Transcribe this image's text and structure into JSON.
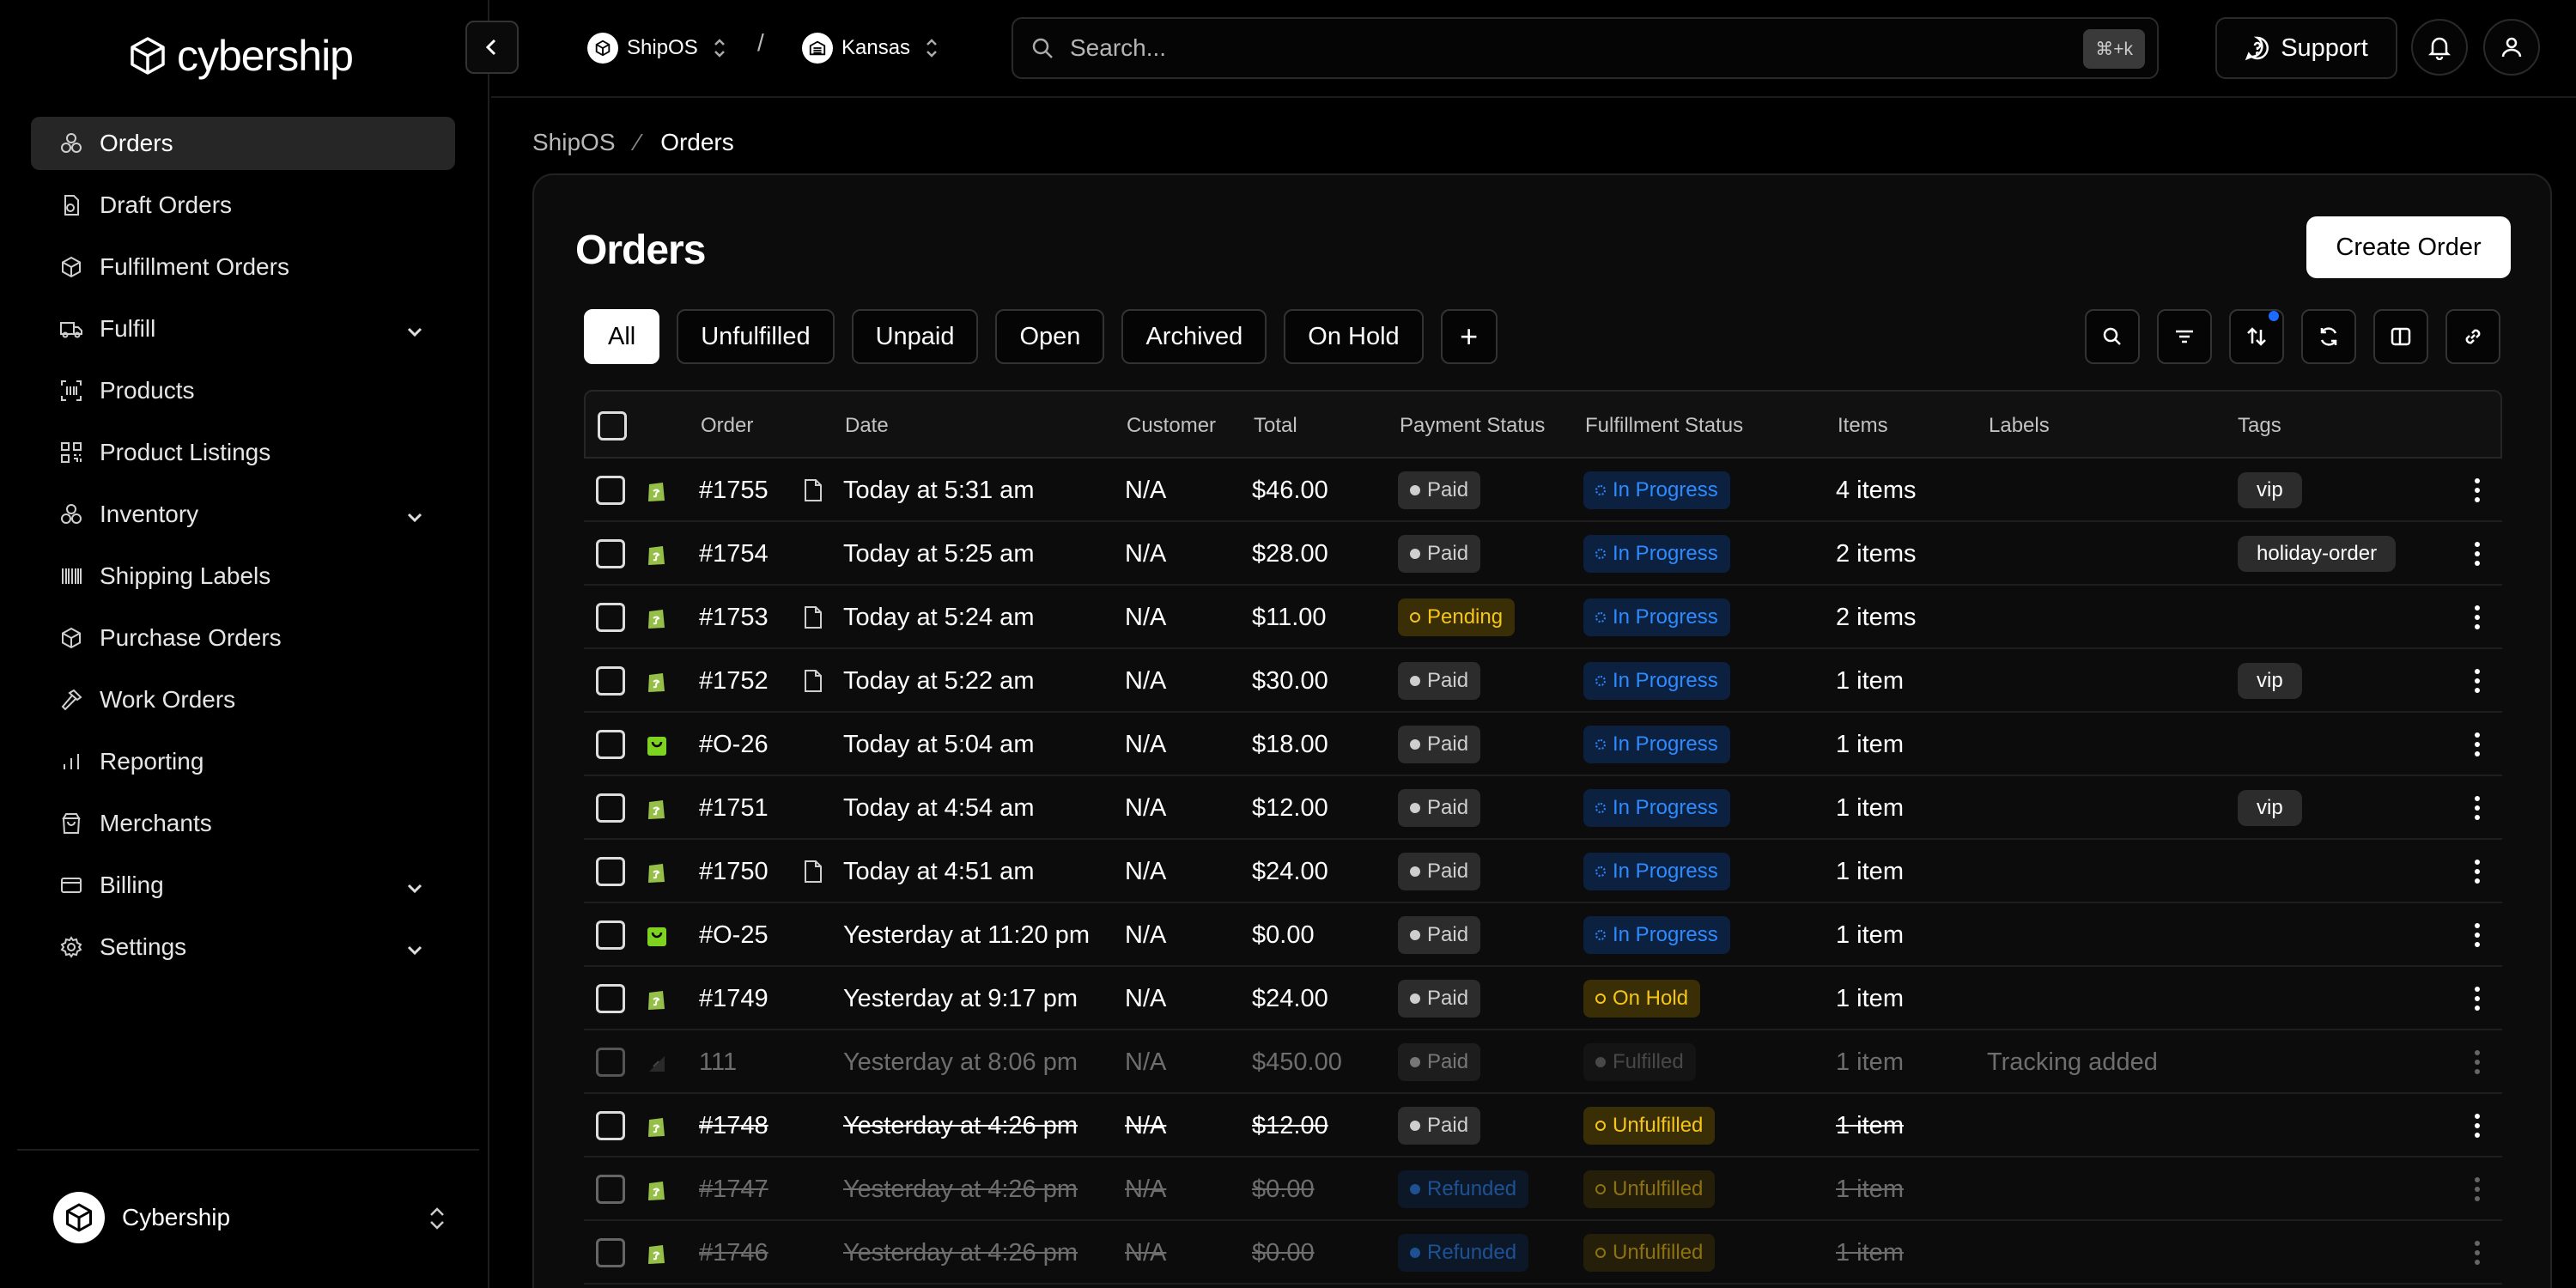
{
  "brand": {
    "name": "cybership"
  },
  "sidebar": {
    "items": [
      {
        "label": "Orders",
        "icon": "orders-icon",
        "active": true,
        "expandable": false
      },
      {
        "label": "Draft Orders",
        "icon": "draft-orders-icon",
        "expandable": false
      },
      {
        "label": "Fulfillment Orders",
        "icon": "package-icon",
        "expandable": false
      },
      {
        "label": "Fulfill",
        "icon": "truck-icon",
        "expandable": true
      },
      {
        "label": "Products",
        "icon": "barcode-scan-icon",
        "expandable": false
      },
      {
        "label": "Product Listings",
        "icon": "qr-code-icon",
        "expandable": false
      },
      {
        "label": "Inventory",
        "icon": "boxes-icon",
        "expandable": true
      },
      {
        "label": "Shipping Labels",
        "icon": "barcode-icon",
        "expandable": false
      },
      {
        "label": "Purchase Orders",
        "icon": "package-icon",
        "expandable": false
      },
      {
        "label": "Work Orders",
        "icon": "hammer-icon",
        "expandable": false
      },
      {
        "label": "Reporting",
        "icon": "bar-chart-icon",
        "expandable": false
      },
      {
        "label": "Merchants",
        "icon": "shopping-bag-icon",
        "expandable": false
      },
      {
        "label": "Billing",
        "icon": "credit-card-icon",
        "expandable": true
      },
      {
        "label": "Settings",
        "icon": "gear-icon",
        "expandable": true
      }
    ],
    "org": {
      "name": "Cybership"
    }
  },
  "topbar": {
    "workspace": "ShipOS",
    "location": "Kansas",
    "search_placeholder": "Search...",
    "search_shortcut": "⌘+k",
    "support_label": "Support"
  },
  "breadcrumb": {
    "parent": "ShipOS",
    "current": "Orders"
  },
  "page": {
    "title": "Orders",
    "create_label": "Create Order",
    "tabs": [
      "All",
      "Unfulfilled",
      "Unpaid",
      "Open",
      "Archived",
      "On Hold"
    ],
    "add_tab": "+"
  },
  "table": {
    "headers": {
      "order": "Order",
      "date": "Date",
      "customer": "Customer",
      "total": "Total",
      "payment": "Payment Status",
      "fulfillment": "Fulfillment Status",
      "items": "Items",
      "labels": "Labels",
      "tags": "Tags"
    },
    "rows": [
      {
        "store": "shopify",
        "order": "#1755",
        "note": true,
        "date": "Today at 5:31 am",
        "customer": "N/A",
        "total": "$46.00",
        "payment": "Paid",
        "fulfillment": "In Progress",
        "items": "4 items",
        "labels": "",
        "tag": "vip",
        "style": "normal"
      },
      {
        "store": "shopify",
        "order": "#1754",
        "note": false,
        "date": "Today at 5:25 am",
        "customer": "N/A",
        "total": "$28.00",
        "payment": "Paid",
        "fulfillment": "In Progress",
        "items": "2 items",
        "labels": "",
        "tag": "holiday-order",
        "style": "normal"
      },
      {
        "store": "shopify",
        "order": "#1753",
        "note": true,
        "date": "Today at 5:24 am",
        "customer": "N/A",
        "total": "$11.00",
        "payment": "Pending",
        "fulfillment": "In Progress",
        "items": "2 items",
        "labels": "",
        "tag": "",
        "style": "normal"
      },
      {
        "store": "shopify",
        "order": "#1752",
        "note": true,
        "date": "Today at 5:22 am",
        "customer": "N/A",
        "total": "$30.00",
        "payment": "Paid",
        "fulfillment": "In Progress",
        "items": "1 item",
        "labels": "",
        "tag": "vip",
        "style": "normal"
      },
      {
        "store": "other",
        "order": "#O-26",
        "note": false,
        "date": "Today at 5:04 am",
        "customer": "N/A",
        "total": "$18.00",
        "payment": "Paid",
        "fulfillment": "In Progress",
        "items": "1 item",
        "labels": "",
        "tag": "",
        "style": "normal"
      },
      {
        "store": "shopify",
        "order": "#1751",
        "note": false,
        "date": "Today at 4:54 am",
        "customer": "N/A",
        "total": "$12.00",
        "payment": "Paid",
        "fulfillment": "In Progress",
        "items": "1 item",
        "labels": "",
        "tag": "vip",
        "style": "normal"
      },
      {
        "store": "shopify",
        "order": "#1750",
        "note": true,
        "date": "Today at 4:51 am",
        "customer": "N/A",
        "total": "$24.00",
        "payment": "Paid",
        "fulfillment": "In Progress",
        "items": "1 item",
        "labels": "",
        "tag": "",
        "style": "normal"
      },
      {
        "store": "other",
        "order": "#O-25",
        "note": false,
        "date": "Yesterday at 11:20 pm",
        "customer": "N/A",
        "total": "$0.00",
        "payment": "Paid",
        "fulfillment": "In Progress",
        "items": "1 item",
        "labels": "",
        "tag": "",
        "style": "normal"
      },
      {
        "store": "shopify",
        "order": "#1749",
        "note": false,
        "date": "Yesterday at 9:17 pm",
        "customer": "N/A",
        "total": "$24.00",
        "payment": "Paid",
        "fulfillment": "On Hold",
        "items": "1 item",
        "labels": "",
        "tag": "",
        "style": "normal"
      },
      {
        "store": "manual",
        "order": "111",
        "note": false,
        "date": "Yesterday at 8:06 pm",
        "customer": "N/A",
        "total": "$450.00",
        "payment": "Paid",
        "fulfillment": "Fulfilled",
        "items": "1 item",
        "labels": "Tracking added",
        "tag": "",
        "style": "dim"
      },
      {
        "store": "shopify",
        "order": "#1748",
        "note": false,
        "date": "Yesterday at 4:26 pm",
        "customer": "N/A",
        "total": "$12.00",
        "payment": "Paid",
        "fulfillment": "Unfulfilled",
        "items": "1 item",
        "labels": "",
        "tag": "",
        "style": "strike"
      },
      {
        "store": "shopify",
        "order": "#1747",
        "note": false,
        "date": "Yesterday at 4:26 pm",
        "customer": "N/A",
        "total": "$0.00",
        "payment": "Refunded",
        "fulfillment": "Unfulfilled",
        "items": "1 item",
        "labels": "",
        "tag": "",
        "style": "strike-faded"
      },
      {
        "store": "shopify",
        "order": "#1746",
        "note": false,
        "date": "Yesterday at 4:26 pm",
        "customer": "N/A",
        "total": "$0.00",
        "payment": "Refunded",
        "fulfillment": "Unfulfilled",
        "items": "1 item",
        "labels": "",
        "tag": "",
        "style": "strike-faded"
      }
    ]
  },
  "colors": {
    "accent": "#2e8bff",
    "warning": "#f5c518",
    "shopify_green": "#95bf47",
    "other_green": "#7ed321"
  }
}
